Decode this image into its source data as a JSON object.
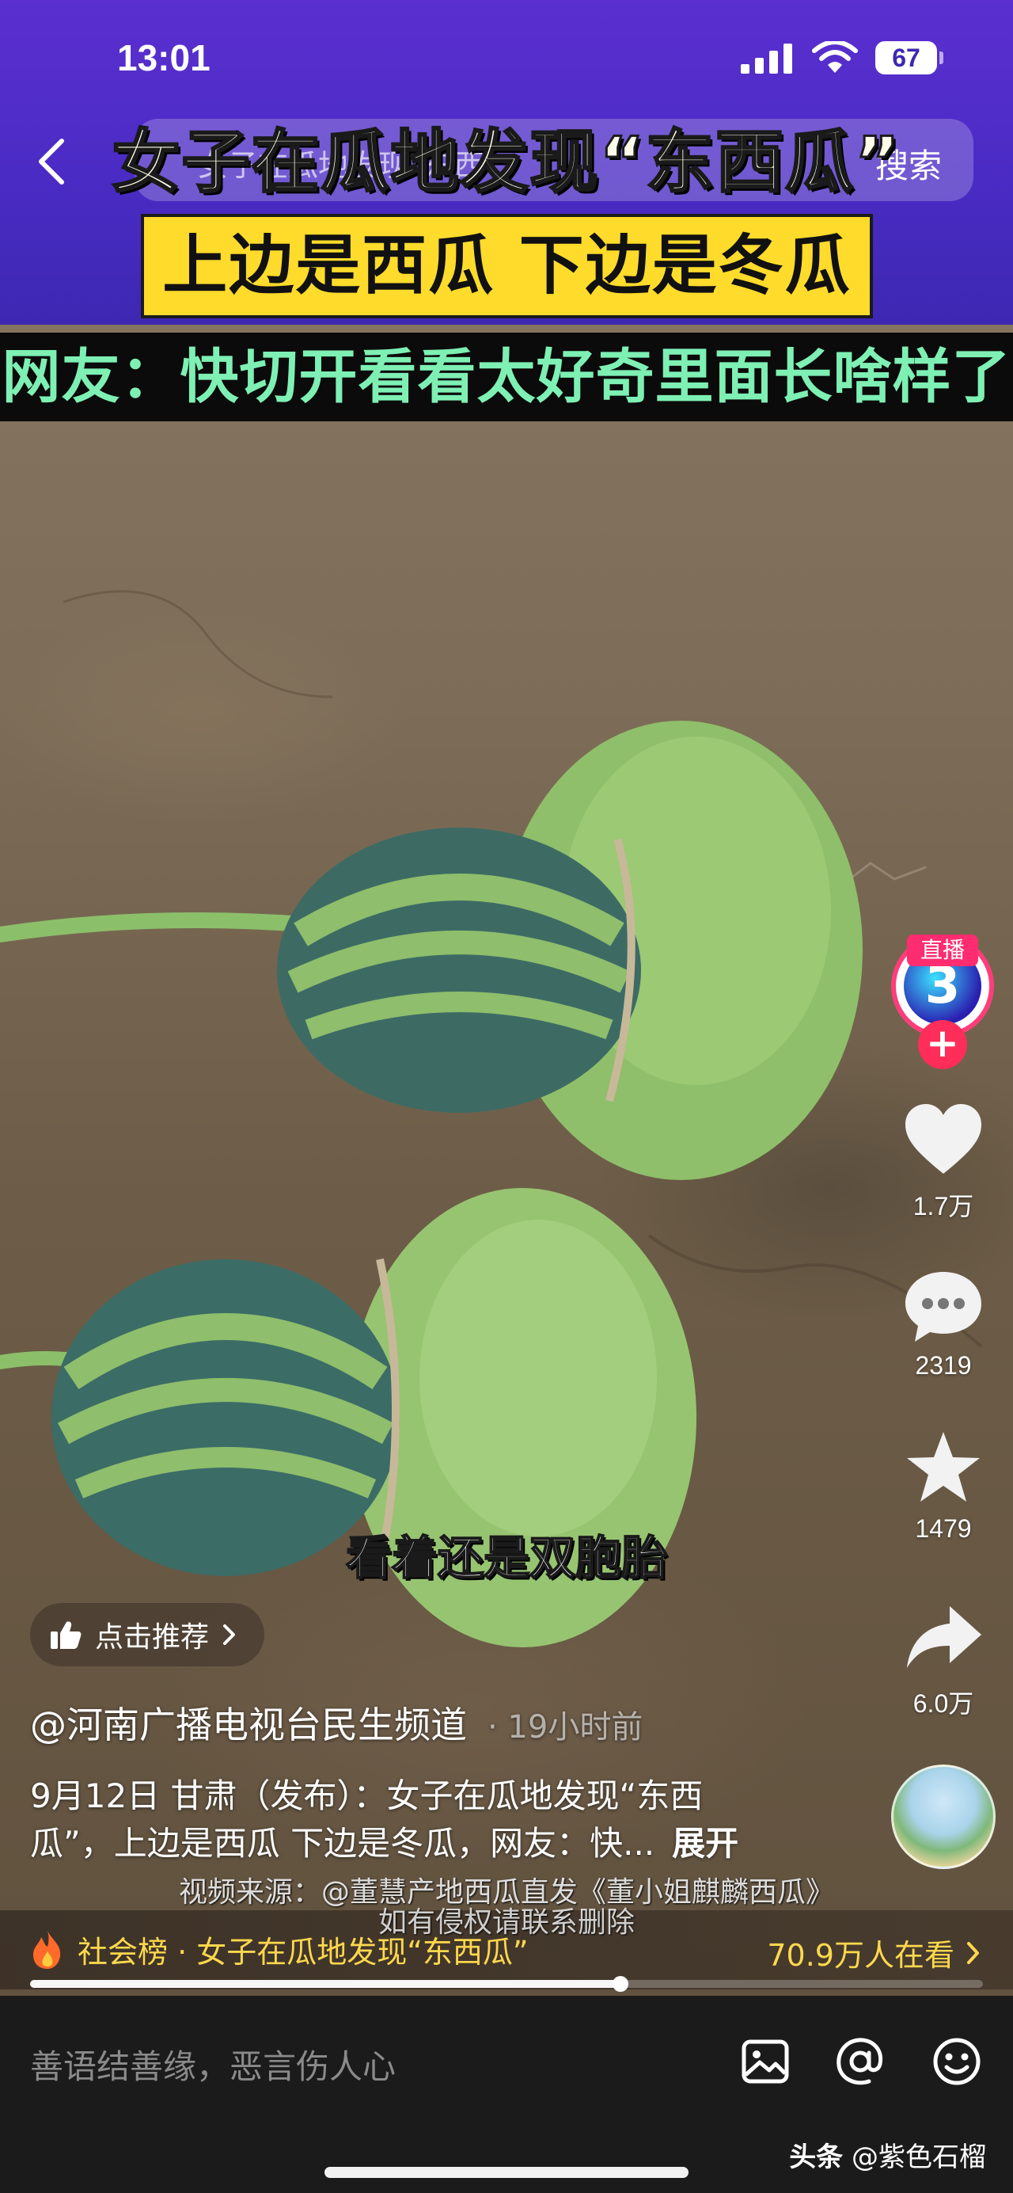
{
  "status_bar": {
    "time": "13:01",
    "battery": "67"
  },
  "search": {
    "placeholder": "女子在瓜地发现“东西",
    "button": "搜索"
  },
  "video": {
    "headline_1": "女子在瓜地发现“东西瓜”",
    "headline_2": "上边是西瓜 下边是冬瓜",
    "headline_3": "网友：快切开看看太好奇里面长啥样了",
    "subtitle": "看着还是双胞胎",
    "progress": 0.62
  },
  "rail": {
    "live_badge": "直播",
    "live_number": "3",
    "follow": "+",
    "like_count": "1.7万",
    "comment_count": "2319",
    "favorite_count": "1479",
    "share_count": "6.0万"
  },
  "post": {
    "recommend": "点击推荐",
    "author": "@河南广播电视台民生频道",
    "time": "· 19小时前",
    "desc_line_1": "9月12日 甘肃（发布）：女子在瓜地发现“东西",
    "desc_line_2": "瓜”，上边是西瓜 下边是冬瓜，网友：快...",
    "expand": "展开",
    "source_line_1": "视频来源：@董慧产地西瓜直发《董小姐麒麟西瓜》",
    "source_line_2": "如有侵权请联系删除"
  },
  "hot": {
    "label": "社会榜 · 女子在瓜地发现“东西瓜”",
    "viewers": "70.9万人在看"
  },
  "bottom": {
    "comment_placeholder": "善语结善缘，恶言伤人心",
    "watermark_prefix": "头条",
    "watermark_user": "@紫色石榴"
  },
  "colors": {
    "top_band": "#4a2bc4",
    "headline_yellow": "#ffdb2b",
    "headline_green": "#7ef0b4",
    "hot_text": "#ffd84d"
  }
}
